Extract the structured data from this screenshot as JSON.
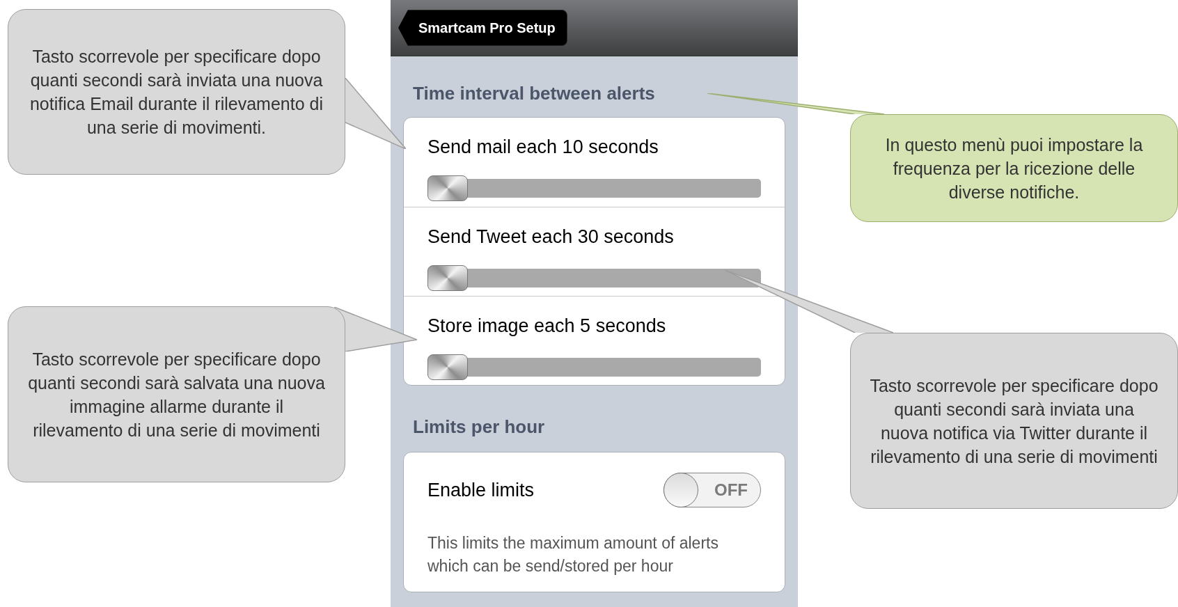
{
  "nav_bar": {
    "back_button": "Smartcam Pro Setup"
  },
  "sections": [
    {
      "header": "Time interval between alerts",
      "rows": [
        {
          "kind": "slider",
          "label": "Send mail each 10 seconds",
          "level": 0
        },
        {
          "kind": "slider",
          "label": "Send Tweet each 30 seconds",
          "level": 0
        },
        {
          "kind": "slider",
          "label": "Store image each 5 seconds",
          "level": 0
        }
      ]
    },
    {
      "header": "Limits per hour",
      "rows": [
        {
          "kind": "toggle",
          "label": "Enable limits",
          "on": false,
          "state_text": "OFF"
        },
        {
          "kind": "note",
          "label": "This limits the maximum amount of alerts which can be send/stored per hour"
        }
      ]
    }
  ],
  "callouts": [
    {
      "kind": "gray",
      "text": "Tasto scorrevole per specificare dopo quanti secondi sarà inviata una nuova notifica Email durante il rilevamento di una serie di movimenti."
    },
    {
      "kind": "gray",
      "text": "Tasto scorrevole per specificare dopo quanti secondi sarà salvata una nuova immagine allarme durante il rilevamento di una serie di movimenti"
    },
    {
      "kind": "green",
      "text": "In questo menù puoi impostare la frequenza per la ricezione delle diverse notifiche."
    },
    {
      "kind": "gray",
      "text": "Tasto scorrevole per specificare dopo quanti secondi sarà inviata una nuova notifica via Twitter durante il rilevamento di una serie di movimenti"
    }
  ]
}
